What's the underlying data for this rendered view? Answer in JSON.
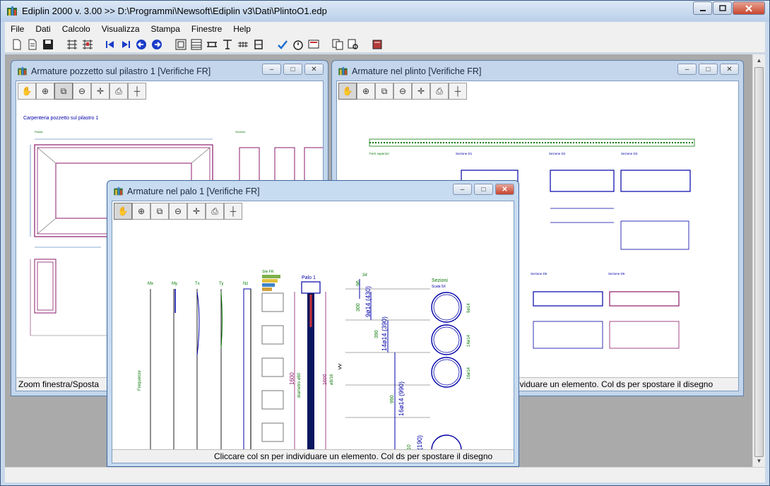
{
  "app": {
    "title": "Ediplin 2000 v. 3.00 >> D:\\Programmi\\Newsoft\\Ediplin v3\\Dati\\PlintoO1.edp",
    "window_buttons": [
      "minimize",
      "maximize",
      "close"
    ]
  },
  "menu": {
    "items": [
      "File",
      "Dati",
      "Calcolo",
      "Visualizza",
      "Stampa",
      "Finestre",
      "Help"
    ]
  },
  "toolbar": {
    "icons": [
      "new-file-icon",
      "new-doc-icon",
      "save-icon",
      "grid-icon",
      "grid-alt-icon",
      "first-icon",
      "last-icon",
      "back-icon",
      "forward-icon",
      "frame-icon",
      "table-icon",
      "beam-icon",
      "column-icon",
      "rebar-icon",
      "stirrup-icon",
      "check-icon",
      "timer-icon",
      "display-icon",
      "copy-icon",
      "print-preview-icon",
      "book-icon"
    ]
  },
  "window_pozzetto": {
    "title": "Armature pozzetto sul pilastro 1 [Verifiche FR]",
    "drawing_title": "Carpenteria pozzetto sul pilastro 1",
    "plan_label": "Pianta",
    "section_label": "Sezione",
    "status": "Zoom finestra/Sposta"
  },
  "window_plinto": {
    "title": "Armature nel plinto [Verifiche FR]",
    "top_bars_label": "Ferri superiori",
    "sections": [
      "Sezione D1",
      "Sezione D2",
      "Sezione D3",
      "Sezione D4",
      "Sezione D5",
      "Sezione D6"
    ],
    "status": "ividuare un elemento. Col ds per spostare il disegno"
  },
  "window_palo": {
    "title": "Armature nel palo 1 [Verifiche FR]",
    "column_labels": [
      "Mx",
      "My",
      "Tx",
      "Ty",
      "Nz"
    ],
    "vertical_label": "Frequenze",
    "file_label": "Sile FR",
    "pile_label": "Palo 1",
    "pile_length": "1600",
    "pile_diameter": "diametro ø60",
    "right_length": "1600",
    "stirrup_spec": "ø8/16",
    "top_dim": "34",
    "dims": [
      "96",
      "300",
      "390",
      "990",
      "10"
    ],
    "bars": [
      "9ø14 (430)",
      "14ø14 (390)",
      "16ø14 (990)",
      "(190)"
    ],
    "sections_title": "Sezioni",
    "sections_scale": "Scala 5X",
    "section_bar_labels": [
      "9ø14",
      "14ø14",
      "16ø14"
    ],
    "status": "Cliccare col sn per individuare un elemento. Col ds per spostare il disegno"
  },
  "child_toolbar": [
    "pan-hand-icon",
    "zoom-in-icon",
    "zoom-window-icon",
    "zoom-out-icon",
    "center-target-icon",
    "print-icon",
    "bars-icon"
  ],
  "colors": {
    "drawing_purple": "#8b1a6b",
    "drawing_blue": "#0000a8",
    "drawing_green": "#0a7a0a",
    "drawing_dim": "#1c5fb0",
    "drawing_gray": "#6a6a6a"
  }
}
